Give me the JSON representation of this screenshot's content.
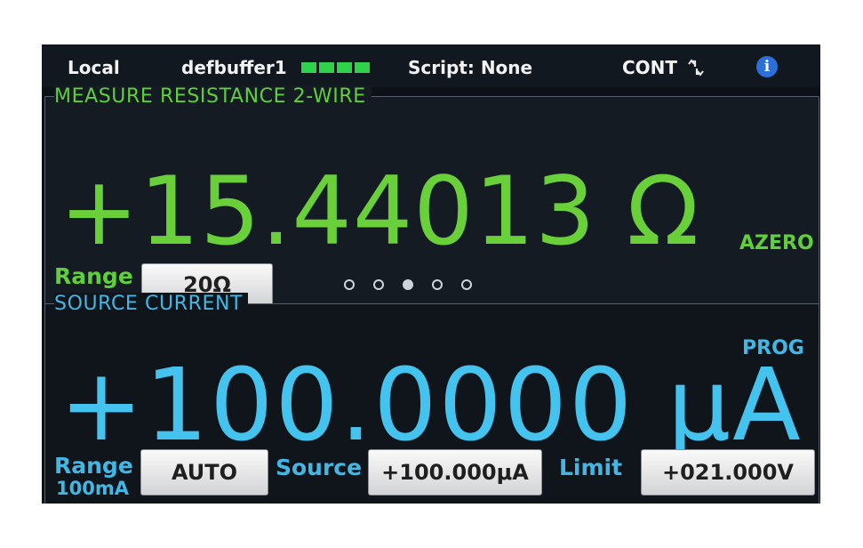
{
  "status_bar": {
    "mode": "Local",
    "buffer": "defbuffer1",
    "script": "Script: None",
    "trigger": "CONT",
    "buffer_color": "#2fd24a",
    "trigger_icon": "trigger-cycle-icon",
    "info_icon": "info-icon",
    "info_symbol": "i"
  },
  "measure": {
    "title": "MEASURE RESISTANCE 2-WIRE",
    "value": "+15.44013 Ω",
    "flag": "AZERO",
    "range_label": "Range",
    "range_value": "20Ω",
    "color": "#6ad03a"
  },
  "pagination": {
    "count": 5,
    "active": 3
  },
  "source": {
    "title": "SOURCE CURRENT",
    "value": "+100.0000 μA",
    "flag": "PROG",
    "range_label": "Range",
    "range_sub": "100mA",
    "range_value": "AUTO",
    "source_label": "Source",
    "source_value": "+100.000μA",
    "limit_label": "Limit",
    "limit_value": "+021.000V",
    "color": "#45c3ef"
  }
}
